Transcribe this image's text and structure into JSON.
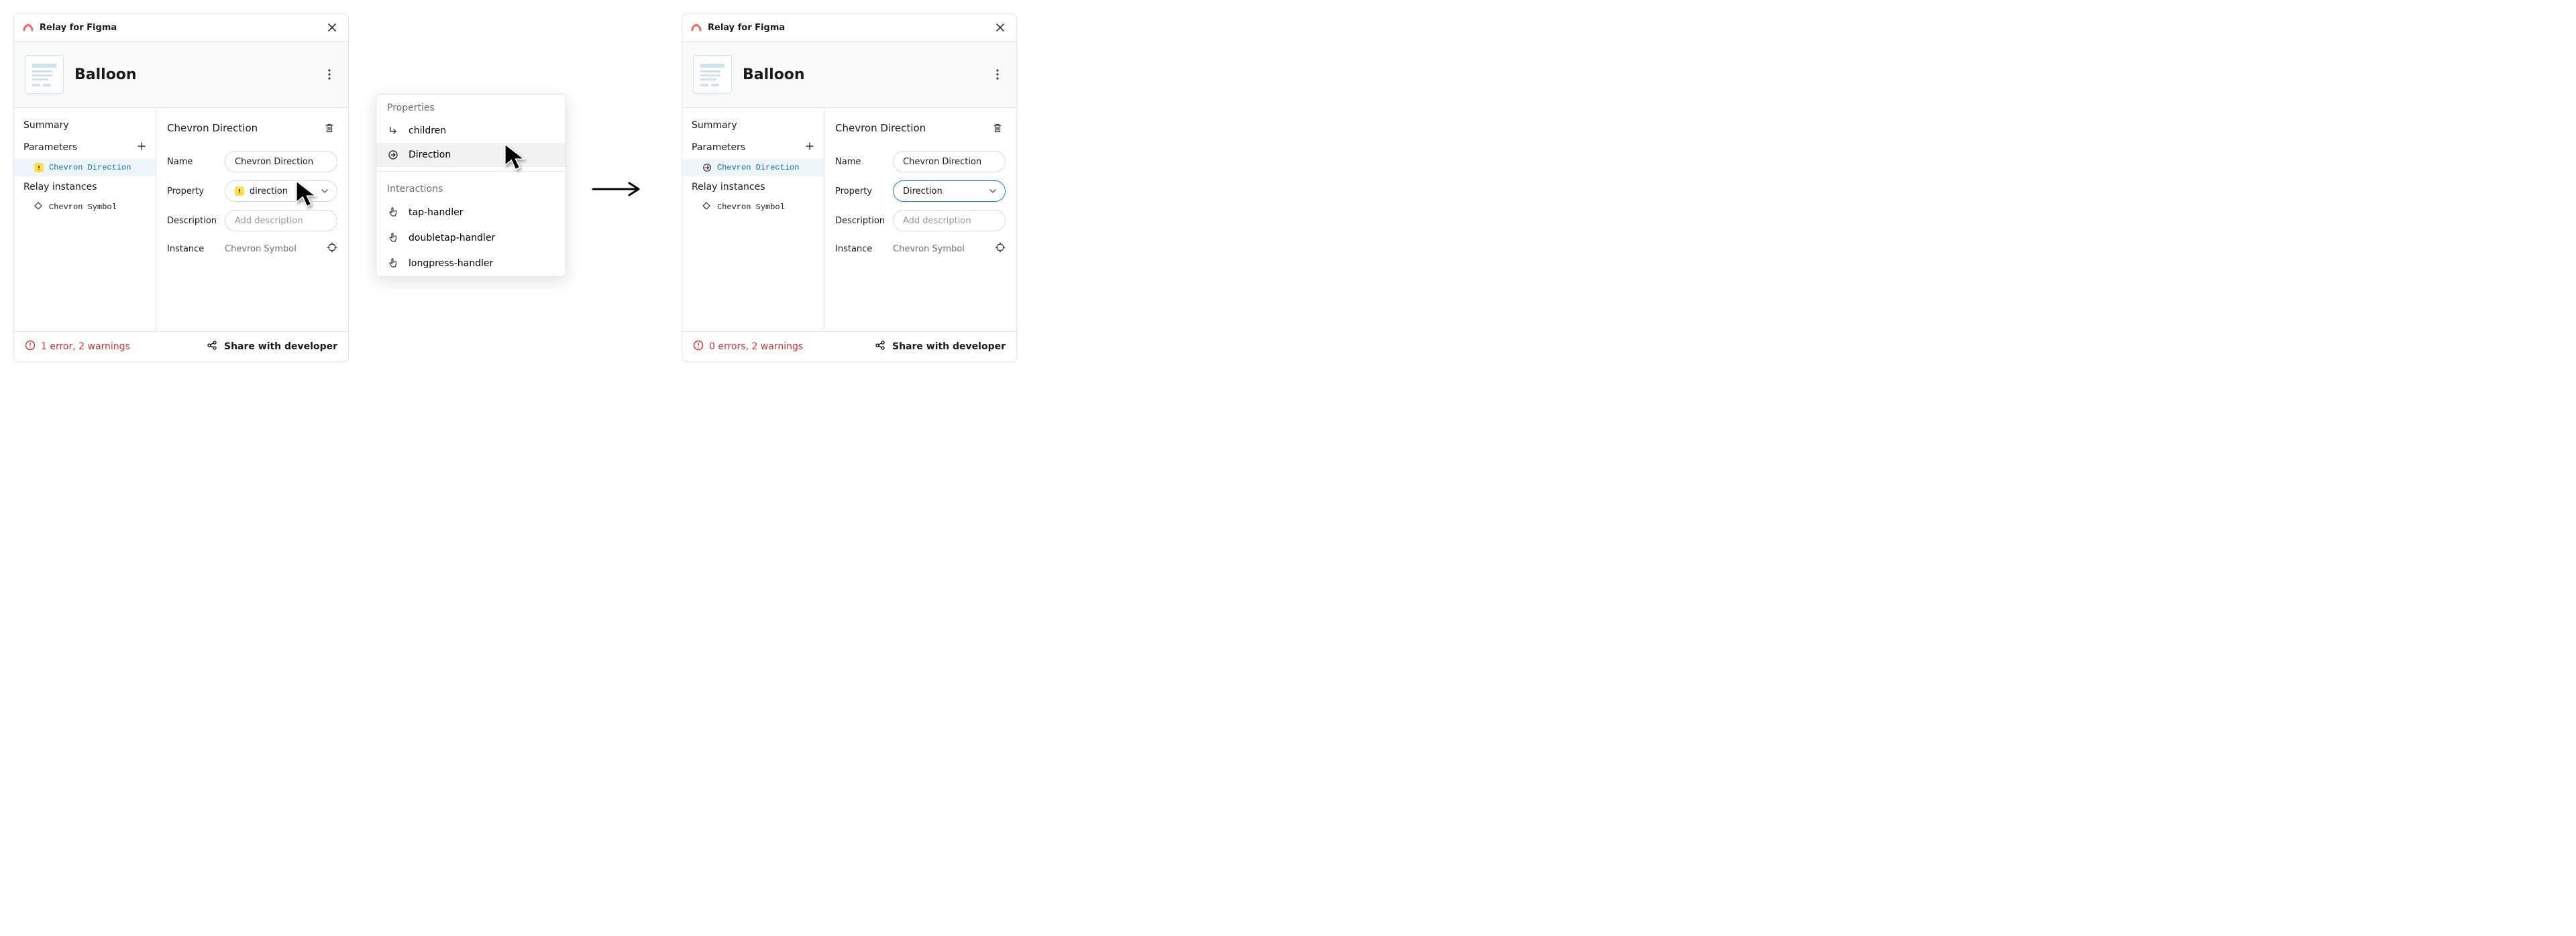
{
  "app_title": "Relay for Figma",
  "left": {
    "component_name": "Balloon",
    "sidebar": {
      "summary_label": "Summary",
      "parameters_label": "Parameters",
      "selected_param": "Chevron Direction",
      "selected_param_warn": true,
      "relay_instances_label": "Relay instances",
      "instance_0": "Chevron Symbol"
    },
    "editor": {
      "title": "Chevron Direction",
      "name_label": "Name",
      "name_value": "Chevron Direction",
      "property_label": "Property",
      "property_value": "direction",
      "property_warn": true,
      "description_label": "Description",
      "description_placeholder": "Add description",
      "instance_label": "Instance",
      "instance_value": "Chevron Symbol"
    },
    "footer": {
      "status": "1 error, 2 warnings",
      "share_label": "Share with developer"
    }
  },
  "popover": {
    "group_properties": "Properties",
    "properties": {
      "children": "children",
      "direction": "Direction"
    },
    "group_interactions": "Interactions",
    "interactions": {
      "tap": "tap-handler",
      "doubletap": "doubletap-handler",
      "longpress": "longpress-handler"
    }
  },
  "right": {
    "component_name": "Balloon",
    "sidebar": {
      "summary_label": "Summary",
      "parameters_label": "Parameters",
      "selected_param": "Chevron Direction",
      "relay_instances_label": "Relay instances",
      "instance_0": "Chevron Symbol"
    },
    "editor": {
      "title": "Chevron Direction",
      "name_label": "Name",
      "name_value": "Chevron Direction",
      "property_label": "Property",
      "property_value": "Direction",
      "description_label": "Description",
      "description_placeholder": "Add description",
      "instance_label": "Instance",
      "instance_value": "Chevron Symbol"
    },
    "footer": {
      "status": "0 errors, 2 warnings",
      "share_label": "Share with developer"
    }
  }
}
